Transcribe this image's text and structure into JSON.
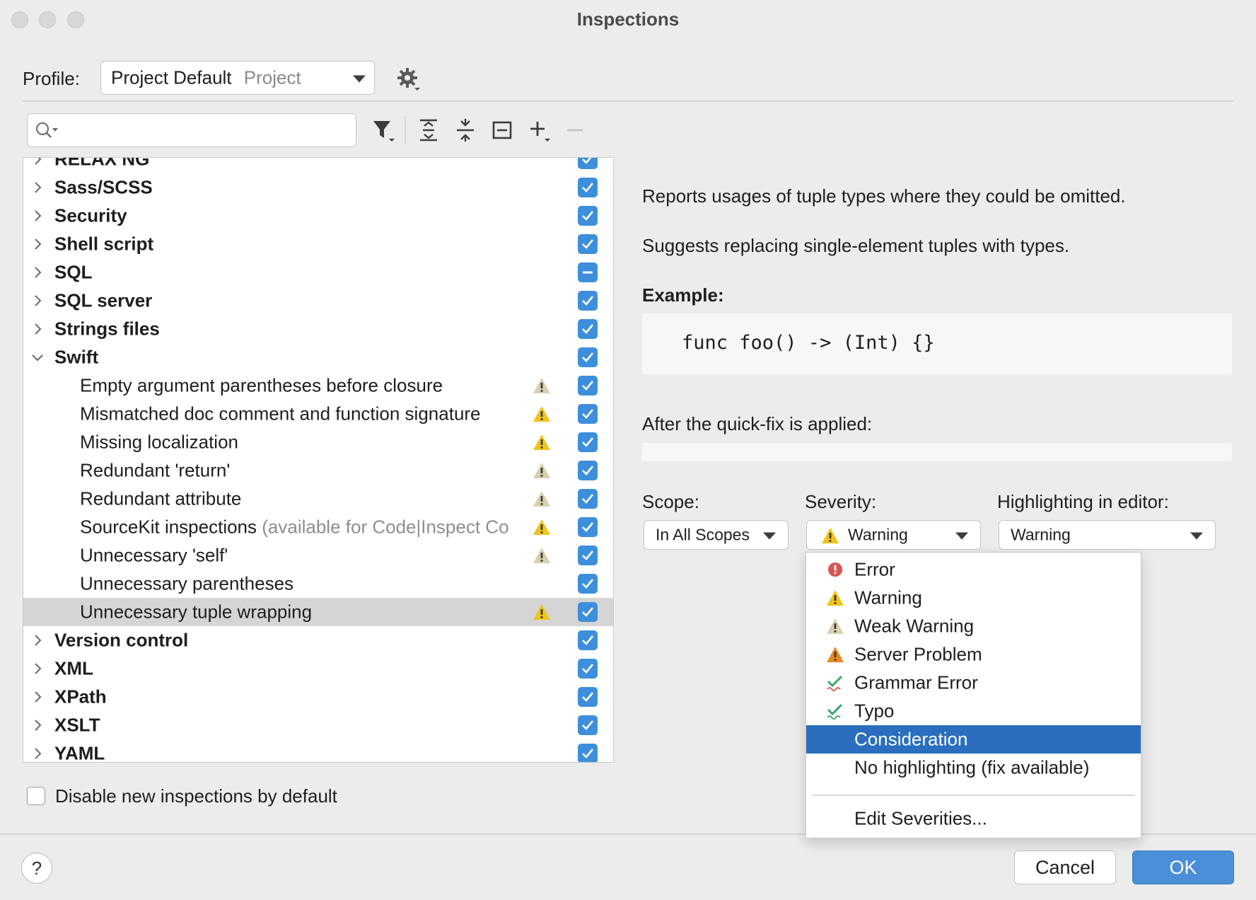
{
  "window": {
    "title": "Inspections"
  },
  "profile": {
    "label": "Profile:",
    "value": "Project Default",
    "value_hint": "Project"
  },
  "search": {
    "placeholder": ""
  },
  "tree": {
    "rows": [
      {
        "label": "RELAX NG",
        "kind": "group",
        "expanded": false,
        "checked": "checked",
        "partial_visible": true
      },
      {
        "label": "Sass/SCSS",
        "kind": "group",
        "expanded": false,
        "checked": "checked"
      },
      {
        "label": "Security",
        "kind": "group",
        "expanded": false,
        "checked": "checked"
      },
      {
        "label": "Shell script",
        "kind": "group",
        "expanded": false,
        "checked": "checked"
      },
      {
        "label": "SQL",
        "kind": "group",
        "expanded": false,
        "checked": "indeterminate"
      },
      {
        "label": "SQL server",
        "kind": "group",
        "expanded": false,
        "checked": "checked"
      },
      {
        "label": "Strings files",
        "kind": "group",
        "expanded": false,
        "checked": "checked"
      },
      {
        "label": "Swift",
        "kind": "group",
        "expanded": true,
        "checked": "checked"
      },
      {
        "label": "Empty argument parentheses before closure",
        "kind": "child",
        "severity": "weak-warning",
        "checked": "checked"
      },
      {
        "label": "Mismatched doc comment and function signature",
        "kind": "child",
        "severity": "warning",
        "checked": "checked"
      },
      {
        "label": "Missing localization",
        "kind": "child",
        "severity": "warning",
        "checked": "checked"
      },
      {
        "label": "Redundant 'return'",
        "kind": "child",
        "severity": "weak-warning",
        "checked": "checked"
      },
      {
        "label": "Redundant attribute",
        "kind": "child",
        "severity": "weak-warning",
        "checked": "checked"
      },
      {
        "label": "SourceKit inspections",
        "suffix": "(available for Code|Inspect Co",
        "kind": "child",
        "severity": "warning",
        "checked": "checked"
      },
      {
        "label": "Unnecessary 'self'",
        "kind": "child",
        "severity": "weak-warning",
        "checked": "checked"
      },
      {
        "label": "Unnecessary parentheses",
        "kind": "child",
        "severity": "none",
        "checked": "checked"
      },
      {
        "label": "Unnecessary tuple wrapping",
        "kind": "child",
        "severity": "warning",
        "checked": "checked",
        "selected": true
      },
      {
        "label": "Version control",
        "kind": "group",
        "expanded": false,
        "checked": "checked"
      },
      {
        "label": "XML",
        "kind": "group",
        "expanded": false,
        "checked": "checked"
      },
      {
        "label": "XPath",
        "kind": "group",
        "expanded": false,
        "checked": "checked"
      },
      {
        "label": "XSLT",
        "kind": "group",
        "expanded": false,
        "checked": "checked"
      },
      {
        "label": "YAML",
        "kind": "group",
        "expanded": false,
        "checked": "checked"
      }
    ]
  },
  "description": {
    "line1": "Reports usages of tuple types where they could be omitted.",
    "line2": "Suggests replacing single-element tuples with types.",
    "example_label": "Example:",
    "example_code": "func foo() -> (Int) {}",
    "after_label": "After the quick-fix is applied:"
  },
  "options": {
    "scope_label": "Scope:",
    "scope_value": "In All Scopes",
    "severity_label": "Severity:",
    "severity_value": "Warning",
    "highlight_label": "Highlighting in editor:",
    "highlight_value": "Warning"
  },
  "severity_menu": {
    "items": [
      {
        "label": "Error",
        "icon": "error-icon"
      },
      {
        "label": "Warning",
        "icon": "warning-icon"
      },
      {
        "label": "Weak Warning",
        "icon": "weak-warning-icon"
      },
      {
        "label": "Server Problem",
        "icon": "server-problem-icon"
      },
      {
        "label": "Grammar Error",
        "icon": "grammar-check-icon"
      },
      {
        "label": "Typo",
        "icon": "typo-check-icon"
      },
      {
        "label": "Consideration",
        "icon": "",
        "active": true
      },
      {
        "label": "No highlighting (fix available)",
        "icon": ""
      }
    ],
    "edit_label": "Edit Severities..."
  },
  "footer": {
    "disable_new_label": "Disable new inspections by default",
    "help_label": "?",
    "cancel_label": "Cancel",
    "ok_label": "OK"
  },
  "colors": {
    "accent": "#3d8fdb",
    "selection": "#2a6ebd",
    "warning": "#f0c419",
    "weak_warning": "#d9cfae",
    "error": "#d9534f",
    "server_problem": "#e8881e"
  }
}
